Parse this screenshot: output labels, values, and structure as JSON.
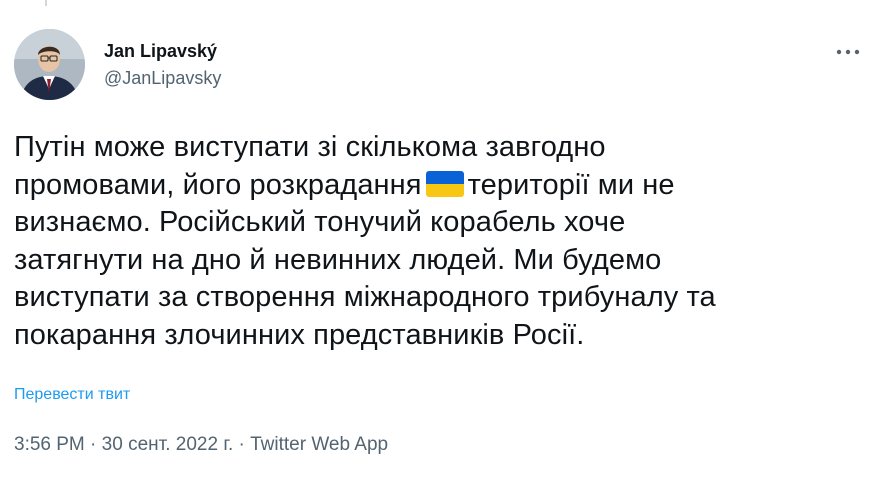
{
  "author": {
    "name": "Jan Lipavský",
    "handle": "@JanLipavsky"
  },
  "tweet": {
    "line1": "Путін може виступати зі скількома завгодно",
    "line2_before_flag": "промовами, його  розкрадання",
    "flag_icon": "ukraine-flag-emoji",
    "line2_after_flag": "території ми не",
    "line3": "визнаємо. Російський тонучий корабель хоче",
    "line4": "затягнути на дно й невинних людей. Ми будемо",
    "line5": "виступати за створення міжнародного трибуналу та",
    "line6": "покарання злочинних представників Росії."
  },
  "translate_label": "Перевести твит",
  "meta": {
    "time": "3:56 PM",
    "sep1": " · ",
    "date": "30 сент. 2022 г.",
    "sep2": " · ",
    "app": "Twitter Web App"
  },
  "colors": {
    "link": "#1d9bf0",
    "secondary_text": "#536471",
    "flag_blue": "#0a63d6",
    "flag_yellow": "#f7c714"
  }
}
